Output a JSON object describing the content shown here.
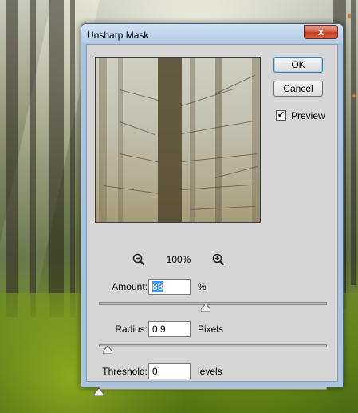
{
  "dialog": {
    "title": "Unsharp Mask",
    "close_glyph": "x",
    "ok_label": "OK",
    "cancel_label": "Cancel",
    "preview_label": "Preview",
    "preview_checked": true,
    "zoom_level": "100%"
  },
  "params": {
    "amount": {
      "label": "Amount:",
      "value": "88",
      "unit": "%",
      "slider_fraction": 0.47
    },
    "radius": {
      "label": "Radius:",
      "value": "0.9",
      "unit": "Pixels",
      "slider_fraction": 0.04
    },
    "threshold": {
      "label": "Threshold:",
      "value": "0",
      "unit": "levels",
      "slider_fraction": 0.0
    }
  },
  "icons": {
    "zoom_out": "zoom-out-icon",
    "zoom_in": "zoom-in-icon",
    "close": "close-icon",
    "check": "checkmark-icon"
  },
  "colors": {
    "title_bar": "#b4cbe6",
    "close_button": "#c0381d",
    "dialog_body": "#d6d6d6",
    "selection": "#3399ff"
  }
}
